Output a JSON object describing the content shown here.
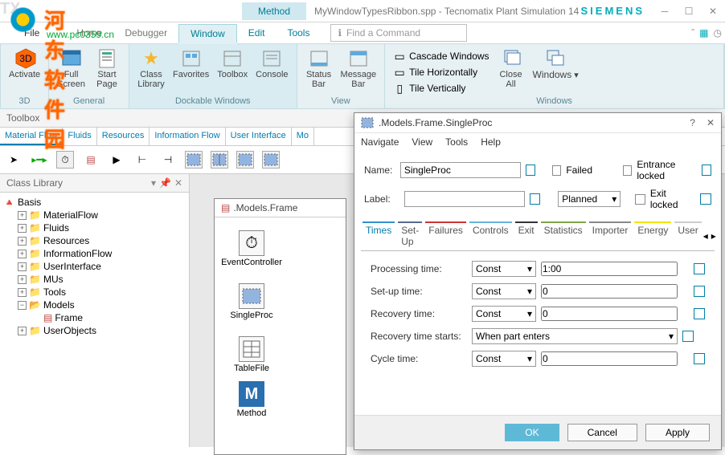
{
  "titlebar": {
    "method": "Method",
    "title": "MyWindowTypesRibbon.spp - Tecnomatix Plant Simulation 14",
    "brand": "SIEMENS"
  },
  "tabs": {
    "file": "File",
    "home": "Home",
    "debugger": "Debugger",
    "window": "Window",
    "edit": "Edit",
    "tools": "Tools",
    "findcmd": "Find a Command"
  },
  "ribbon": {
    "activate": "Activate",
    "full_screen": "Full\nScreen",
    "start_page": "Start\nPage",
    "class_library": "Class\nLibrary",
    "favorites": "Favorites",
    "toolbox": "Toolbox",
    "console": "Console",
    "status_bar": "Status\nBar",
    "message_bar": "Message\nBar",
    "cascade": "Cascade Windows",
    "horiz": "Tile Horizontally",
    "vert": "Tile Vertically",
    "close_all": "Close\nAll",
    "windows": "Windows",
    "grp_3d": "3D",
    "grp_general": "General",
    "grp_dock": "Dockable Windows",
    "grp_view": "View",
    "grp_win": "Windows"
  },
  "toolbox": {
    "title": "Toolbox",
    "tabs": [
      "Material Flow",
      "Fluids",
      "Resources",
      "Information Flow",
      "User Interface",
      "Mo"
    ]
  },
  "classlib": {
    "title": "Class Library",
    "root": "Basis",
    "items": [
      "MaterialFlow",
      "Fluids",
      "Resources",
      "InformationFlow",
      "UserInterface",
      "MUs",
      "Tools",
      "Models",
      "UserObjects"
    ],
    "frame": "Frame"
  },
  "frame": {
    "title": ".Models.Frame",
    "objs": [
      "EventController",
      "SingleProc",
      "TableFile",
      "Method"
    ]
  },
  "dialog": {
    "title": ".Models.Frame.SingleProc",
    "menu": [
      "Navigate",
      "View",
      "Tools",
      "Help"
    ],
    "name_lbl": "Name:",
    "name_val": "SingleProc",
    "label_lbl": "Label:",
    "failed": "Failed",
    "entrance": "Entrance locked",
    "planned": "Planned",
    "exit": "Exit locked",
    "tabs": [
      "Times",
      "Set-Up",
      "Failures",
      "Controls",
      "Exit",
      "Statistics",
      "Importer",
      "Energy",
      "User"
    ],
    "rows": {
      "proc": "Processing time:",
      "proc_mode": "Const",
      "proc_val": "1:00",
      "setup": "Set-up time:",
      "setup_mode": "Const",
      "setup_val": "0",
      "rec": "Recovery time:",
      "rec_mode": "Const",
      "rec_val": "0",
      "recstart": "Recovery time starts:",
      "recstart_val": "When part enters",
      "cycle": "Cycle time:",
      "cycle_mode": "Const",
      "cycle_val": "0"
    },
    "ok": "OK",
    "cancel": "Cancel",
    "apply": "Apply"
  },
  "watermark": {
    "text": "河东软件园",
    "url": "www.pc0359.cn",
    "tx": "TX"
  }
}
